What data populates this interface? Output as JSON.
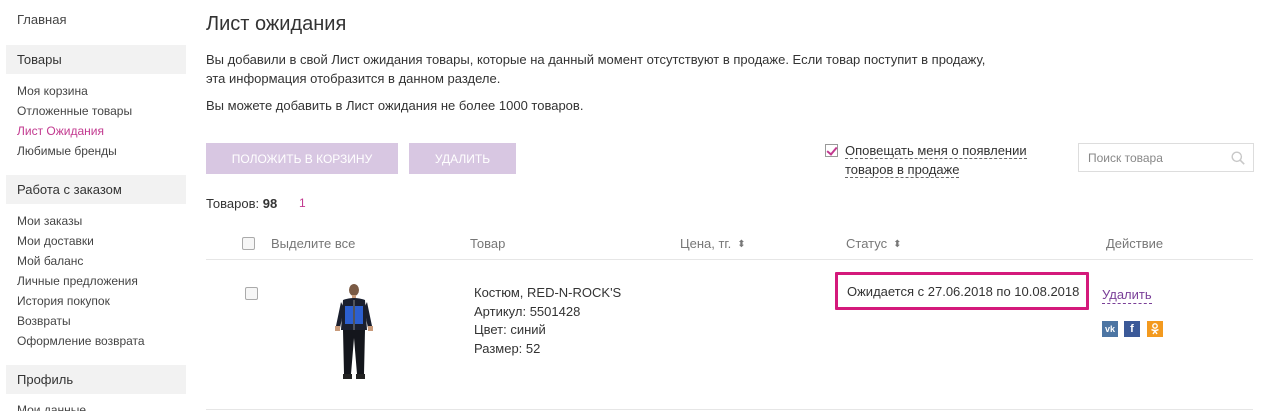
{
  "sidebar": {
    "home": "Главная",
    "sections": [
      {
        "title": "Товары",
        "items": [
          "Моя корзина",
          "Отложенные товары",
          "Лист Ожидания",
          "Любимые бренды"
        ]
      },
      {
        "title": "Работа с заказом",
        "items": [
          "Мои заказы",
          "Мои доставки",
          "Мой баланс",
          "Личные предложения",
          "История покупок",
          "Возвраты",
          "Оформление возврата"
        ]
      },
      {
        "title": "Профиль",
        "items": [
          "Мои данные"
        ]
      }
    ],
    "active_item": "Лист Ожидания"
  },
  "page": {
    "title": "Лист ожидания",
    "intro_line1": "Вы добавили в свой Лист ожидания товары, которые на данный момент отсутствуют в продаже. Если товар поступит в продажу,",
    "intro_line2": "эта информация отобразится в данном разделе.",
    "limit_text": "Вы можете добавить в Лист ожидания не более 1000 товаров."
  },
  "toolbar": {
    "add_to_cart_label": "Положить в корзину",
    "delete_label": "Удалить",
    "notify_line1": "Оповещать меня о появлении",
    "notify_line2": "товаров в продаже",
    "notify_checked": true,
    "search_placeholder": "Поиск товара"
  },
  "summary": {
    "count_label": "Товаров:",
    "count_value": "98",
    "page_number": "1"
  },
  "table": {
    "headers": {
      "select_all": "Выделите все",
      "product": "Товар",
      "price": "Цена, тг.",
      "status": "Статус",
      "action": "Действие"
    },
    "rows": [
      {
        "name": "Костюм, RED-N-ROCK'S",
        "article": "Артикул: 5501428",
        "color": "Цвет: синий",
        "size": "Размер: 52",
        "status": "Ожидается с 27.06.2018 по 10.08.2018",
        "delete_label": "Удалить"
      }
    ]
  },
  "icons": {
    "sort": "sort-arrows-icon",
    "search": "search-icon",
    "social": [
      "vk-icon",
      "facebook-icon",
      "odnoklassniki-icon"
    ]
  },
  "colors": {
    "accent": "#c2398f",
    "button": "#d8c7e2",
    "highlight_border": "#d4197b"
  }
}
